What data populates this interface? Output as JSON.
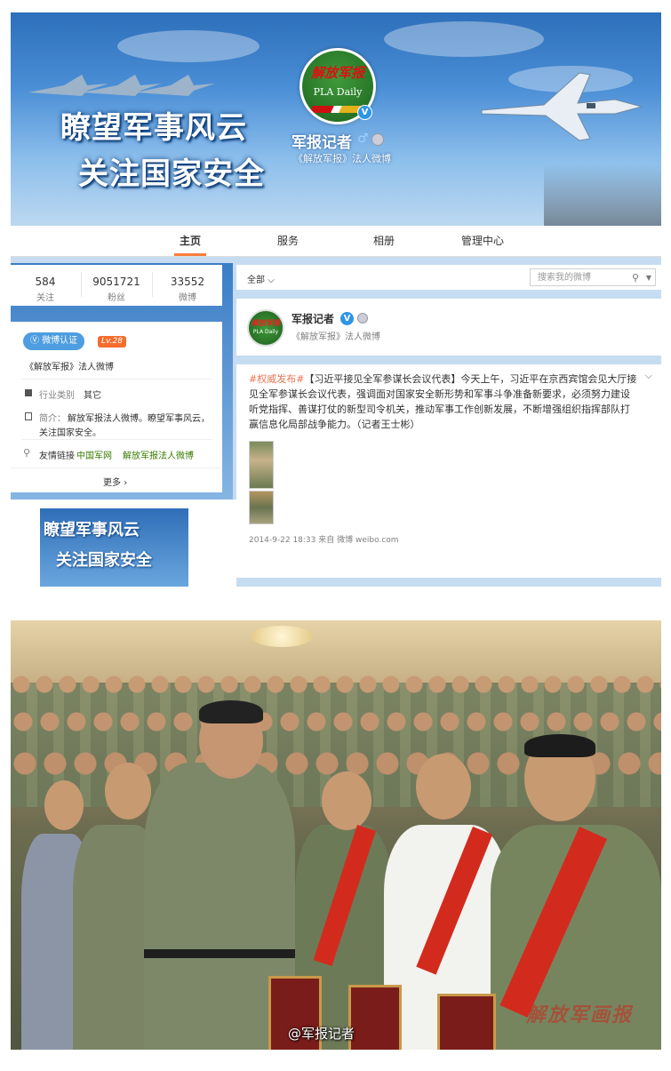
{
  "cover": {
    "slogan_line1": "瞭望军事风云",
    "slogan_line2": "关注国家安全",
    "logo_text_cn": "解放军报",
    "logo_text_en": "PLA Daily",
    "name": "军报记者",
    "gender_icon": "male-icon",
    "verified_sub": "《解放军报》法人微博"
  },
  "tabs": [
    {
      "label": "主页",
      "active": true
    },
    {
      "label": "服务",
      "active": false
    },
    {
      "label": "相册",
      "active": false
    },
    {
      "label": "管理中心",
      "active": false
    }
  ],
  "stats": [
    {
      "value": "584",
      "label": "关注"
    },
    {
      "value": "9051721",
      "label": "粉丝"
    },
    {
      "value": "33552",
      "label": "微博"
    }
  ],
  "sidebar": {
    "verify_badge": "微博认证",
    "level_badge": "Lv.28",
    "verify_desc": "《解放军报》法人微博",
    "industry_label": "行业类别",
    "industry_value": "其它",
    "intro_label": "简介：",
    "intro_text_line1": "解放军报法人微博。瞭望军事风云，",
    "intro_text_line2": "关注国家安全。",
    "links_label": "友情链接",
    "link1": "中国军网",
    "link2": "解放军报法人微博",
    "more": "更多"
  },
  "banner_small": {
    "line1": "瞭望军事风云",
    "line2": "关注国家安全"
  },
  "feed": {
    "filter_label": "全部",
    "search_placeholder": "搜索我的微博",
    "author_name": "军报记者",
    "author_sub": "《解放军报》法人微博",
    "post": {
      "hashtag": "#权威发布#",
      "line1_rest": "【习近平接见全军参谋长会议代表】今天上午，习近平在京西宾馆会见大厅接",
      "line2": "见全军参谋长会议代表，强调面对国家安全新形势和军事斗争准备新要求，必须努力建设",
      "line3": "听党指挥、善谋打仗的新型司令机关，推动军事工作创新发展，不断增强组织指挥部队打",
      "line4": "赢信息化局部战争能力。（记者王士彬）",
      "time": "2014-9-22 18:33",
      "source_prefix": "来自",
      "source": "微博 weibo.com"
    }
  },
  "photo": {
    "watermark": "@军报记者",
    "seal_text": "解放军画报"
  },
  "colors": {
    "accent_orange": "#fa7d3c",
    "verify_blue": "#2d95e6",
    "link_green": "#3b7b00",
    "hashtag": "#eb7350"
  }
}
